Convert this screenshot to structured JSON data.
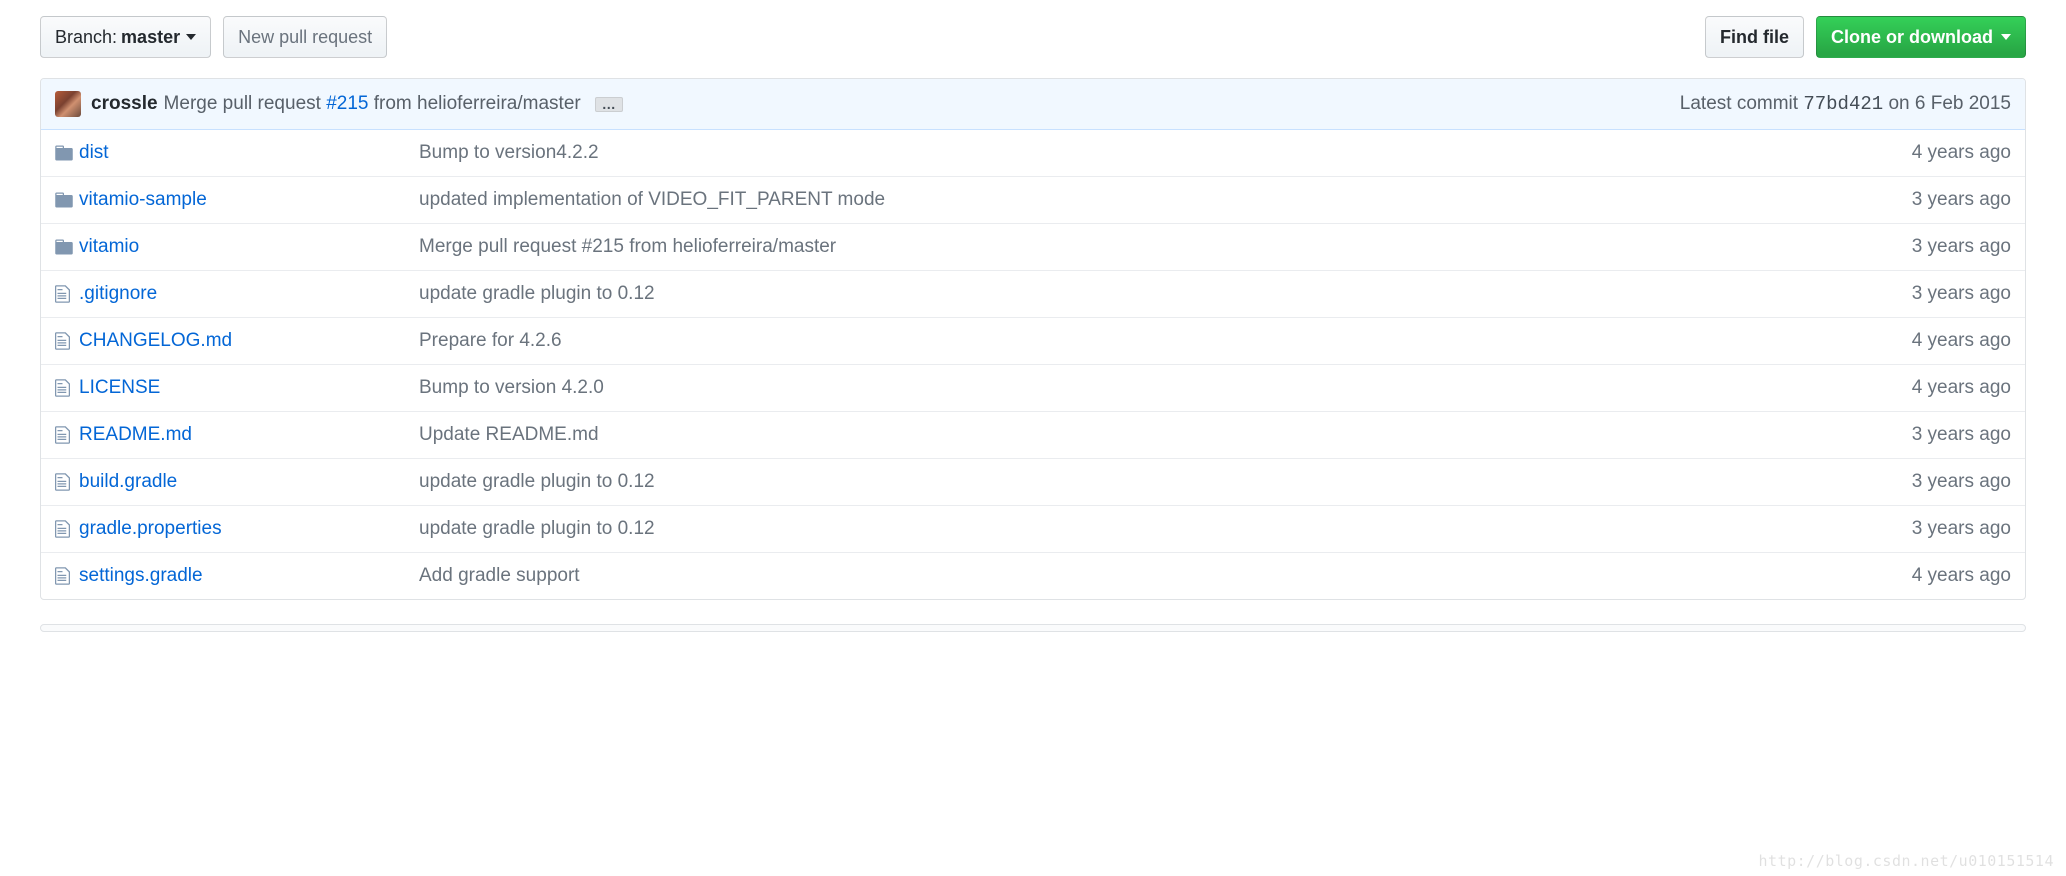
{
  "toolbar": {
    "branch_prefix": "Branch:",
    "branch_name": "master",
    "new_pr": "New pull request",
    "find_file": "Find file",
    "clone": "Clone or download"
  },
  "commit_tease": {
    "author": "crossle",
    "msg_prefix": "Merge pull request ",
    "pr_link": "#215",
    "msg_suffix": " from helioferreira/master",
    "ellipsis": "…",
    "latest_label": "Latest commit ",
    "sha": "77bd421",
    "date": " on 6 Feb 2015"
  },
  "files": [
    {
      "type": "folder",
      "name": "dist",
      "message": "Bump to version4.2.2",
      "age": "4 years ago"
    },
    {
      "type": "folder",
      "name": "vitamio-sample",
      "message": "updated implementation of VIDEO_FIT_PARENT mode",
      "age": "3 years ago"
    },
    {
      "type": "folder",
      "name": "vitamio",
      "message": "Merge pull request #215 from helioferreira/master",
      "age": "3 years ago"
    },
    {
      "type": "file",
      "name": ".gitignore",
      "message": "update gradle plugin to 0.12",
      "age": "3 years ago"
    },
    {
      "type": "file",
      "name": "CHANGELOG.md",
      "message": "Prepare for 4.2.6",
      "age": "4 years ago"
    },
    {
      "type": "file",
      "name": "LICENSE",
      "message": "Bump to version 4.2.0",
      "age": "4 years ago"
    },
    {
      "type": "file",
      "name": "README.md",
      "message": "Update README.md",
      "age": "3 years ago"
    },
    {
      "type": "file",
      "name": "build.gradle",
      "message": "update gradle plugin to 0.12",
      "age": "3 years ago"
    },
    {
      "type": "file",
      "name": "gradle.properties",
      "message": "update gradle plugin to 0.12",
      "age": "3 years ago"
    },
    {
      "type": "file",
      "name": "settings.gradle",
      "message": "Add gradle support",
      "age": "4 years ago"
    }
  ],
  "watermark": "http://blog.csdn.net/u010151514"
}
